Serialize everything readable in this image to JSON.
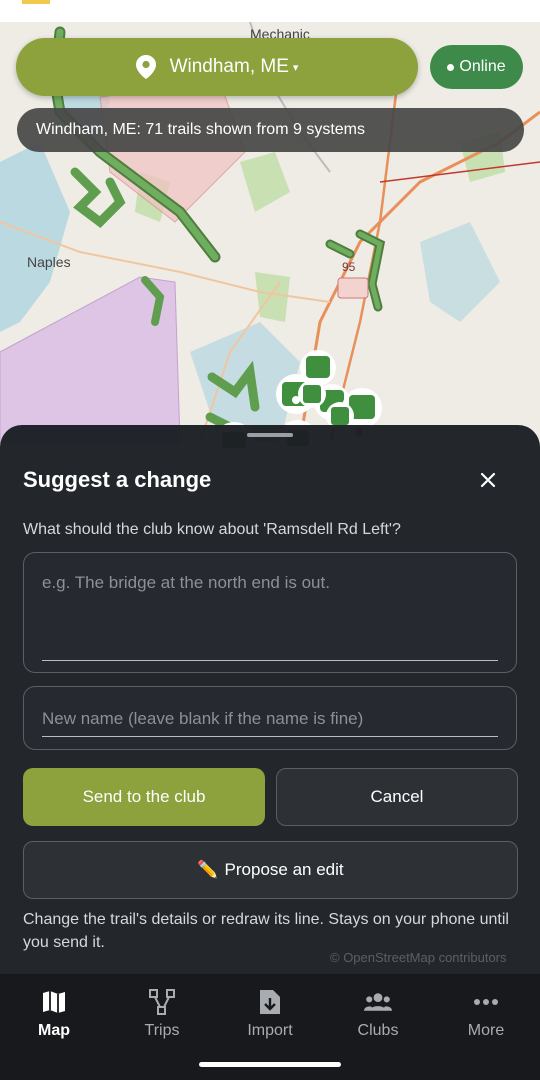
{
  "header": {
    "location_label": "Windham, ME",
    "location_caret": "▾",
    "status_label": "Online",
    "banner_text": "Windham, ME: 71 trails shown from 9 systems"
  },
  "map": {
    "place_labels": [
      "Naples",
      "Mechanic"
    ],
    "road_badge": "95",
    "attribution": "© OpenStreetMap contributors"
  },
  "sheet": {
    "title": "Suggest a change",
    "question": "What should the club know about 'Ramsdell Rd Left'?",
    "description_placeholder": "e.g. The bridge at the north end is out.",
    "name_placeholder": "New name (leave blank if the name is fine)",
    "send_label": "Send to the club",
    "cancel_label": "Cancel",
    "propose_icon": "✏️",
    "propose_label": "Propose an edit",
    "hint": "Change the trail's details or redraw its line. Stays on your phone until you send it."
  },
  "nav": {
    "items": [
      {
        "label": "Map",
        "icon": "map-icon",
        "active": true
      },
      {
        "label": "Trips",
        "icon": "route-icon",
        "active": false
      },
      {
        "label": "Import",
        "icon": "import-file-icon",
        "active": false
      },
      {
        "label": "Clubs",
        "icon": "group-icon",
        "active": false
      },
      {
        "label": "More",
        "icon": "more-dots-icon",
        "active": false
      }
    ]
  },
  "colors": {
    "accent": "#8da13c",
    "online": "#3e8a4a",
    "trail": "#5e9e4e",
    "sheet_bg": "#1c1f24"
  }
}
